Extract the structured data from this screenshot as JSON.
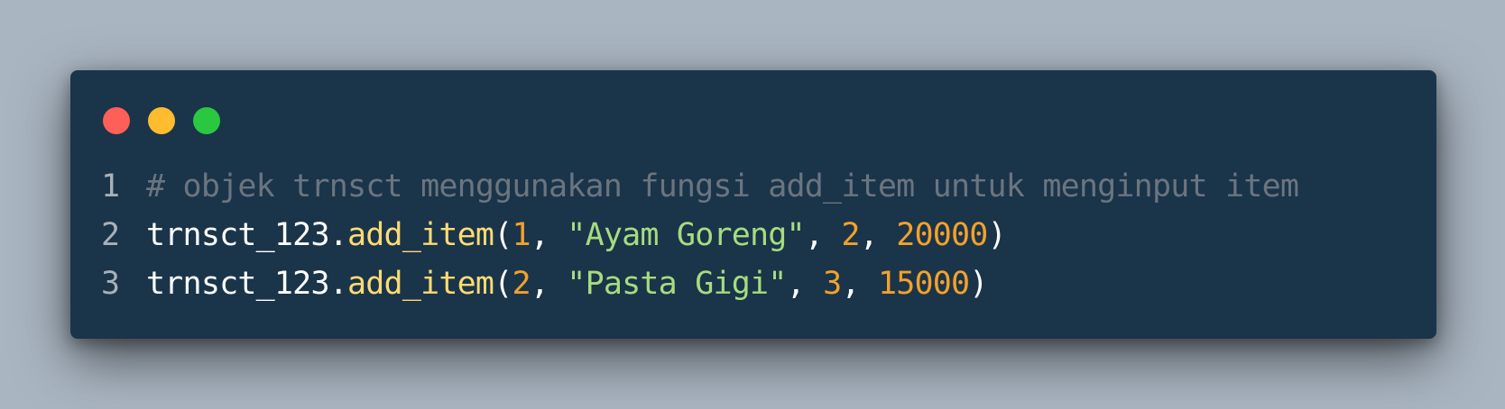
{
  "window": {
    "controls": [
      {
        "name": "close",
        "color": "#fe5f58"
      },
      {
        "name": "minimize",
        "color": "#ffbc2e"
      },
      {
        "name": "maximize",
        "color": "#29c840"
      }
    ]
  },
  "code": {
    "lines": [
      {
        "number": "1",
        "tokens": [
          {
            "type": "comment",
            "text": "# objek trnsct menggunakan fungsi add_item untuk menginput item"
          }
        ]
      },
      {
        "number": "2",
        "tokens": [
          {
            "type": "ident",
            "text": "trnsct_123."
          },
          {
            "type": "func",
            "text": "add_item"
          },
          {
            "type": "punct",
            "text": "("
          },
          {
            "type": "num",
            "text": "1"
          },
          {
            "type": "punct",
            "text": ", "
          },
          {
            "type": "str",
            "text": "\"Ayam Goreng\""
          },
          {
            "type": "punct",
            "text": ", "
          },
          {
            "type": "num",
            "text": "2"
          },
          {
            "type": "punct",
            "text": ", "
          },
          {
            "type": "num",
            "text": "20000"
          },
          {
            "type": "punct",
            "text": ")"
          }
        ]
      },
      {
        "number": "3",
        "tokens": [
          {
            "type": "ident",
            "text": "trnsct_123."
          },
          {
            "type": "func",
            "text": "add_item"
          },
          {
            "type": "punct",
            "text": "("
          },
          {
            "type": "num",
            "text": "2"
          },
          {
            "type": "punct",
            "text": ", "
          },
          {
            "type": "str",
            "text": "\"Pasta Gigi\""
          },
          {
            "type": "punct",
            "text": ", "
          },
          {
            "type": "num",
            "text": "3"
          },
          {
            "type": "punct",
            "text": ", "
          },
          {
            "type": "num",
            "text": "15000"
          },
          {
            "type": "punct",
            "text": ")"
          }
        ]
      }
    ]
  }
}
